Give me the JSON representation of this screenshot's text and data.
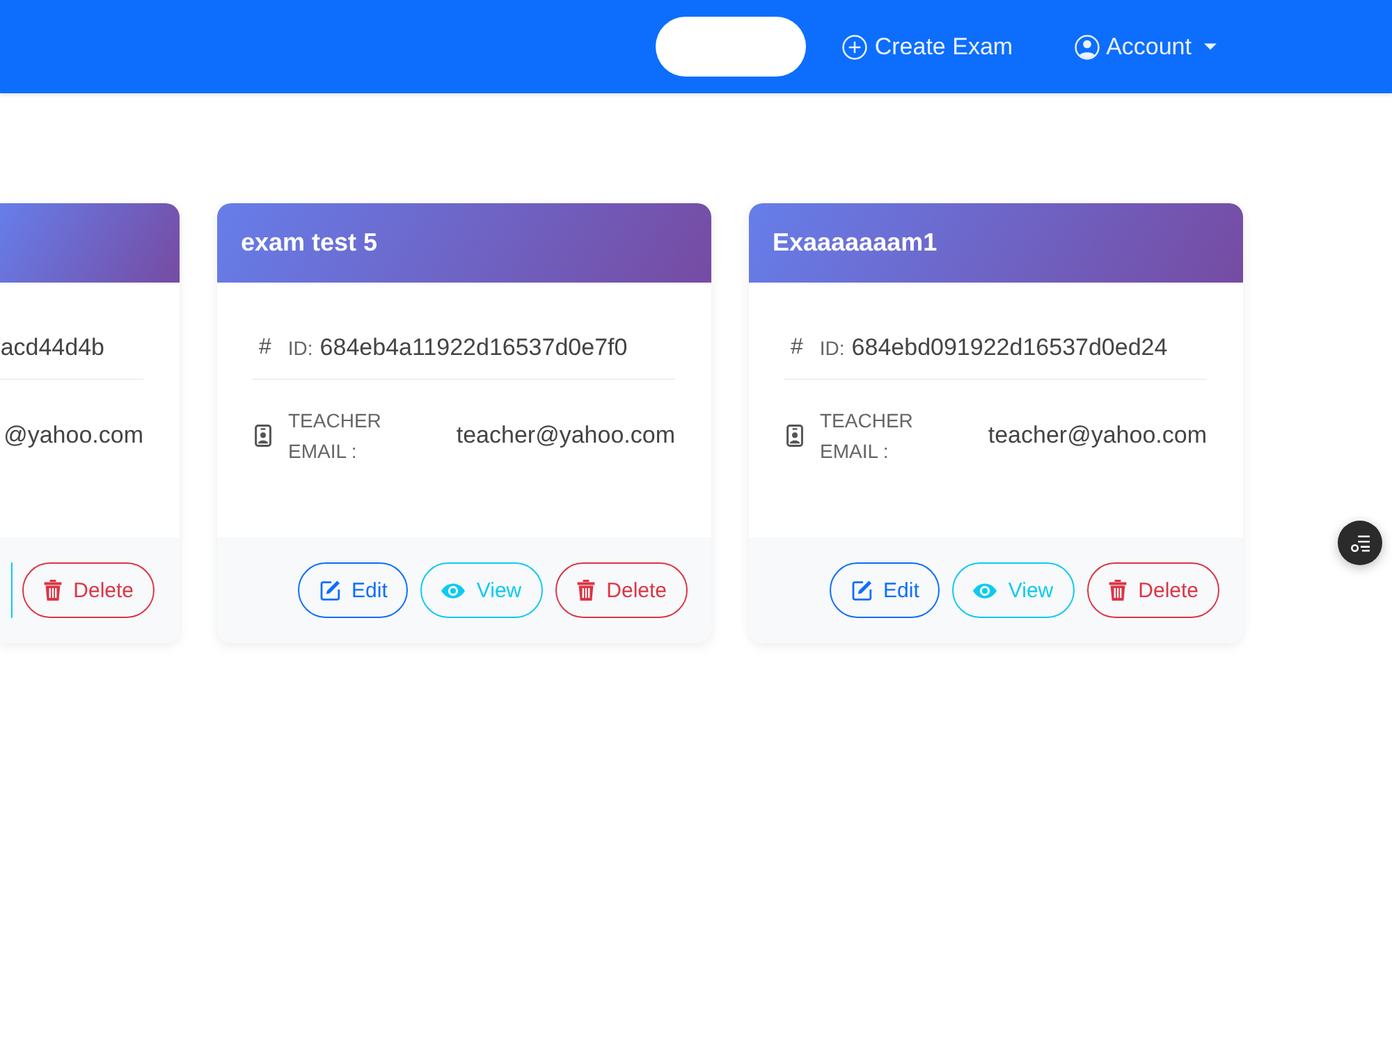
{
  "navbar": {
    "links": [
      {
        "kind": "create",
        "label": "Create Exam"
      },
      {
        "kind": "account",
        "label": "Account",
        "dropdown": true
      }
    ]
  },
  "exams": [
    {
      "kind": "cut",
      "id": "acd44d4b",
      "email": "@yahoo.com",
      "actions": [
        {
          "kind": "view"
        },
        {
          "kind": "delete",
          "label": "Delete"
        }
      ]
    },
    {
      "kind": "full",
      "title": "exam test 5",
      "id_mark": "#",
      "id_label": "ID:",
      "id": "684eb4a11922d16537d0e7f0",
      "email_label": "TEACHER EMAIL :",
      "email": "teacher@yahoo.com",
      "actions": [
        {
          "kind": "edit",
          "label": "Edit"
        },
        {
          "kind": "view",
          "label": "View"
        },
        {
          "kind": "delete",
          "label": "Delete"
        }
      ]
    },
    {
      "kind": "full",
      "title": "Exaaaaaaam1",
      "id_mark": "#",
      "id_label": "ID:",
      "id": "684ebd091922d16537d0ed24",
      "email_label": "TEACHER EMAIL :",
      "email": "teacher@yahoo.com",
      "actions": [
        {
          "kind": "edit",
          "label": "Edit"
        },
        {
          "kind": "view",
          "label": "View"
        },
        {
          "kind": "delete",
          "label": "Delete"
        }
      ]
    }
  ]
}
